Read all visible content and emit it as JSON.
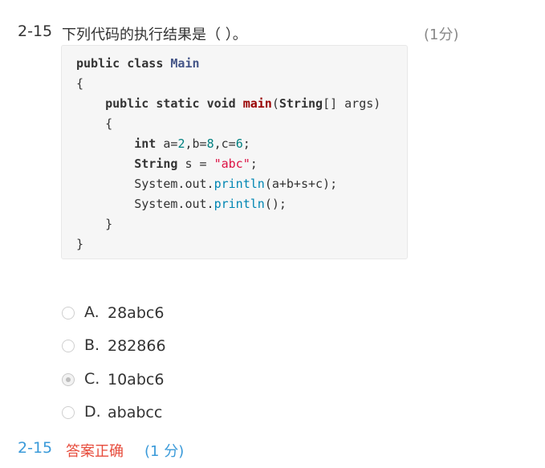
{
  "question": {
    "number": "2-15",
    "text": "下列代码的执行结果是（ ）。",
    "score": "(1分)"
  },
  "code": {
    "line1": {
      "kw1": "public",
      "kw2": "class",
      "name": "Main"
    },
    "line2": "{",
    "line3": {
      "kw1": "public",
      "kw2": "static",
      "kw3": "void",
      "fn": "main",
      "open": "(",
      "type": "String",
      "rest": "[] args)"
    },
    "line4": "{",
    "line5": {
      "kw": "int",
      "a": " a=",
      "n1": "2",
      "b": ",b=",
      "n2": "8",
      "c": ",c=",
      "n3": "6",
      "end": ";"
    },
    "line6": {
      "kw": "String",
      "mid": " s = ",
      "str": "\"abc\"",
      "end": ";"
    },
    "line7": {
      "obj": "System.out.",
      "call": "println",
      "args": "(a+b+s+c);"
    },
    "line8": {
      "obj": "System.out.",
      "call": "println",
      "args": "();"
    },
    "line9": "}",
    "line10": "}"
  },
  "options": [
    {
      "letter": "A.",
      "text": "28abc6",
      "selected": false
    },
    {
      "letter": "B.",
      "text": "282866",
      "selected": false
    },
    {
      "letter": "C.",
      "text": "10abc6",
      "selected": true
    },
    {
      "letter": "D.",
      "text": "ababcc",
      "selected": false
    }
  ],
  "result": {
    "number": "2-15",
    "status": "答案正确",
    "score": "(1 分)"
  },
  "colors": {
    "status_correct": "#e74c3c",
    "accent_blue": "#3a9ad9"
  }
}
